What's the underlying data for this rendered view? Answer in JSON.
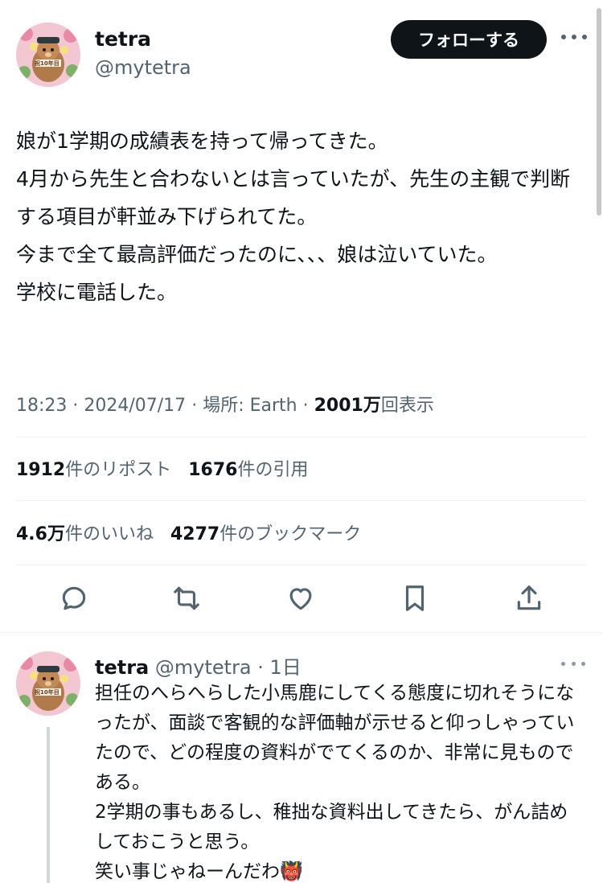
{
  "tweet": {
    "author_name": "tetra",
    "author_handle": "@mytetra",
    "follow_label": "フォローする",
    "text": "娘が1学期の成績表を持って帰ってきた。\n4月から先生と合わないとは言っていたが、先生の主観で判断する項目が軒並み下げられてた。\n今まで全て最高評価だったのに、、、娘は泣いていた。\n学校に電話した。",
    "time": "18:23 · 2024/07/17",
    "location": "場所: Earth · ",
    "views_count": "2001万",
    "views_label": "回表示"
  },
  "stats": {
    "reposts_count": "1912",
    "reposts_label": "件のリポスト",
    "quotes_count": "1676",
    "quotes_label": "件の引用",
    "likes_count": "4.6万",
    "likes_label": "件のいいね",
    "bookmarks_count": "4277",
    "bookmarks_label": "件のブックマーク"
  },
  "actions": {
    "icons": [
      "reply-icon",
      "retweet-icon",
      "like-icon",
      "bookmark-icon",
      "share-icon"
    ]
  },
  "avatar": {
    "badge_text": "祝10年目"
  },
  "reply": {
    "author_name": "tetra",
    "meta": " @mytetra · 1日",
    "text": "担任のへらへらした小馬鹿にしてくる態度に切れそうになったが、面談で客観的な評価軸が示せると仰っしゃっていたので、どの程度の資料がでてくるのか、非常に見ものである。\n2学期の事もあるし、稚拙な資料出してきたら、がん詰めしておこうと思う。\n笑い事じゃねーんだわ👹"
  },
  "colors": {
    "text_primary": "#0f1419",
    "text_secondary": "#536471",
    "follow_bg": "#0f1419",
    "divider": "#eff3f4"
  }
}
